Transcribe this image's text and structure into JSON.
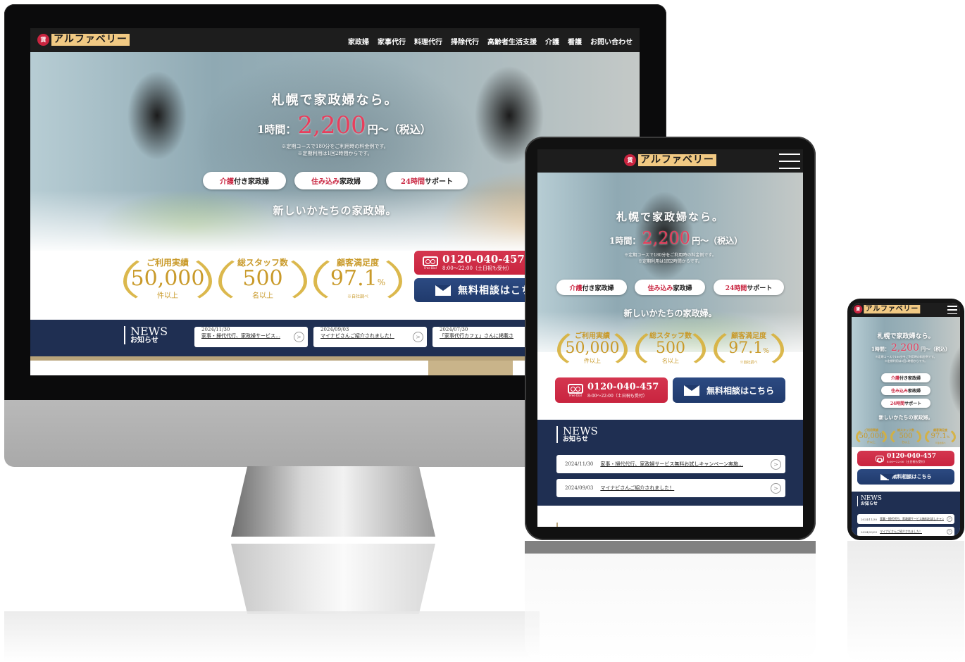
{
  "brand": {
    "logo_mark": "賃",
    "name": "アルファベリー"
  },
  "nav": {
    "items": [
      "家政婦",
      "家事代行",
      "料理代行",
      "掃除代行",
      "高齢者生活支援",
      "介護",
      "看護",
      "お問い合わせ"
    ]
  },
  "hero": {
    "headline": "札幌で家政婦なら。",
    "price_prefix": "1時間：",
    "price_value": "2,200",
    "price_suffix": "円～（税込）",
    "note_line1": "※定期コースで180分をご利用時の料金例です。",
    "note_line2": "※定期利用は1回2時間からです。",
    "pills": [
      {
        "accent": "介護",
        "rest": "付き家政婦"
      },
      {
        "accent": "住み込み",
        "rest": "家政婦"
      },
      {
        "accent": "24時間",
        "rest": "サポート"
      }
    ],
    "tagline": "新しいかたちの家政婦。"
  },
  "stats": [
    {
      "label": "ご利用実績",
      "value": "50,000",
      "unit": "",
      "sub": "件以上"
    },
    {
      "label": "総スタッフ数",
      "value": "500",
      "unit": "",
      "sub": "名以上"
    },
    {
      "label": "顧客満足度",
      "value": "97.1",
      "unit": "%",
      "sub": "※自社調べ"
    }
  ],
  "cta": {
    "phone_number": "0120-040-457",
    "phone_badge": "Free Dial",
    "phone_hours": "8:00～22:00（土日祝も受付）",
    "mail_label": "無料相談はこちら"
  },
  "news": {
    "title_en": "NEWS",
    "title_ja": "お知らせ",
    "items": [
      {
        "date": "2024/11/30",
        "title": "家事・掃代代行、家政婦サービス無料お試しキャンペーン実施…"
      },
      {
        "date": "2024/09/03",
        "title": "マイナビさんご紹介されました！"
      },
      {
        "date": "2024/07/30",
        "title": "「家事代行カフェ」さんに掲載されました"
      }
    ],
    "desktop_titles": [
      "家事・掃代代行、家政婦サービス…",
      "マイナビさんご紹介されました！",
      "「家事代行カフェ」さんに掲載さ"
    ]
  },
  "colors": {
    "accent_red": "#c9243f",
    "navy": "#1f2f52",
    "gold": "#c99a2a",
    "nav_dark": "#1d1d1d"
  },
  "icons": {
    "phone": "free-dial-icon",
    "mail": "mail-icon",
    "arrow": "arrow-circle-icon",
    "menu": "hamburger-icon"
  }
}
